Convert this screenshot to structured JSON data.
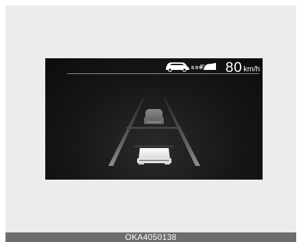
{
  "display": {
    "set_speed_value": "80",
    "set_speed_unit": "km/h",
    "status_icons": [
      "vehicle-ahead-icon",
      "distance-dots-icon",
      "own-vehicle-speed-icon"
    ],
    "scene_icons": [
      "road-lanes",
      "lead-vehicle-icon",
      "own-vehicle-icon"
    ]
  },
  "caption": {
    "code": "OKA4050138"
  },
  "colors": {
    "frame_background": "#ececec",
    "display_background": "#111111",
    "caption_background": "#6d6d6d",
    "text": "#ffffff"
  }
}
